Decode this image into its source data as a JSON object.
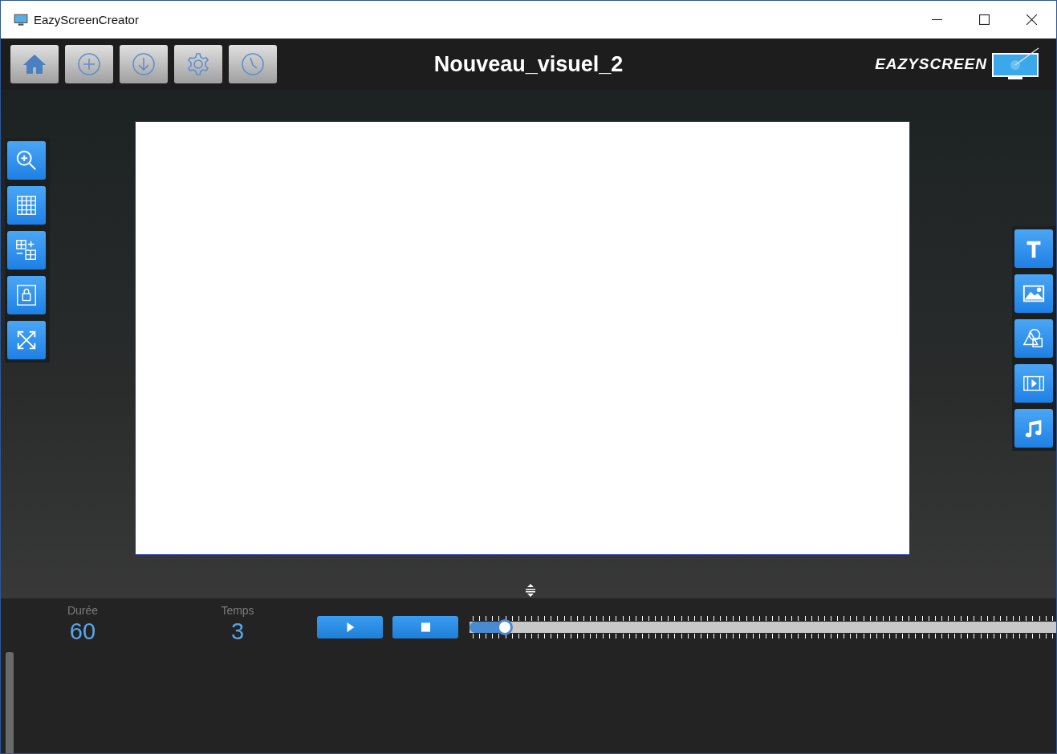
{
  "window": {
    "title": "EazyScreenCreator"
  },
  "toolbar": [
    {
      "kind": "home"
    },
    {
      "kind": "add"
    },
    {
      "kind": "download"
    },
    {
      "kind": "settings"
    },
    {
      "kind": "history"
    }
  ],
  "document_title": "Nouveau_visuel_2",
  "logo": {
    "text": "EAZYSCREEN"
  },
  "left_tools": [
    {
      "kind": "zoom"
    },
    {
      "kind": "grid"
    },
    {
      "kind": "grid-resize"
    },
    {
      "kind": "lock"
    },
    {
      "kind": "fullscreen"
    }
  ],
  "right_tools": [
    {
      "kind": "text"
    },
    {
      "kind": "image"
    },
    {
      "kind": "shapes"
    },
    {
      "kind": "video"
    },
    {
      "kind": "music"
    }
  ],
  "timeline": {
    "duration_label": "Durée",
    "duration": "60",
    "time_label": "Temps",
    "time": "3",
    "level": 0.06
  }
}
